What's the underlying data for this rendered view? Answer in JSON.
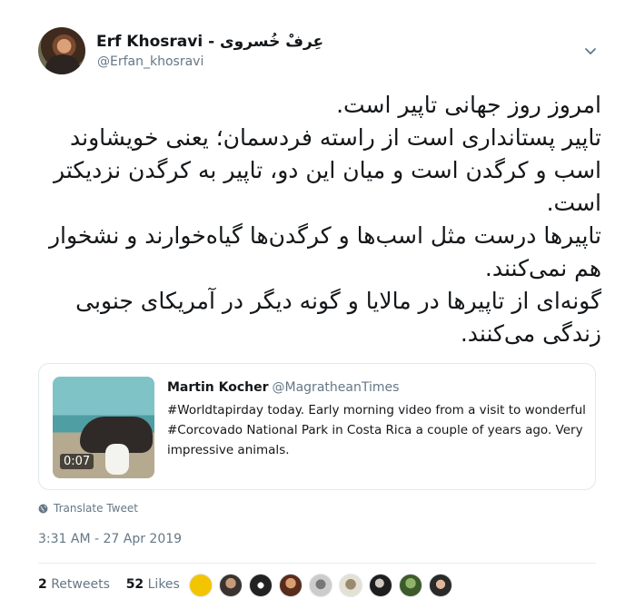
{
  "author": {
    "name": "Erf Khosravi - عِرفْ خُسروی",
    "handle": "@Erfan_khosravi"
  },
  "tweet": {
    "text": "امروز روز جهانی تاپیر است.\nتاپیر پستانداری است از راسته فردسمان؛ یعنی خویشاوند اسب و کرگدن است و میان این دو، تاپیر به کرگدن نزدیکتر است.\nتاپیرها درست مثل اسب‌ها و کرگدن‌ها گیاه‌خوارند و نشخوار هم نمی‌کنند.\nگونه‌ای از تاپیرها در مالایا و گونه دیگر در آمریکای جنوبی زندگی می‌کنند."
  },
  "quoted": {
    "name": "Martin Kocher",
    "handle": "@MagratheanTimes",
    "text": "#Worldtapirday today. Early morning video from a visit to wonderful #Corcovado National Park in Costa Rica a couple of years ago. Very impressive animals.",
    "duration": "0:07"
  },
  "translate_label": "Translate Tweet",
  "timestamp": "3:31 AM - 27 Apr 2019",
  "stats": {
    "retweets_count": "2",
    "retweets_label": "Retweets",
    "likes_count": "52",
    "likes_label": "Likes"
  },
  "icons": {
    "menu": "chevron-down-icon",
    "translate": "globe-icon"
  },
  "colors": {
    "secondary_text": "#657786",
    "border": "#e1e8ed"
  }
}
